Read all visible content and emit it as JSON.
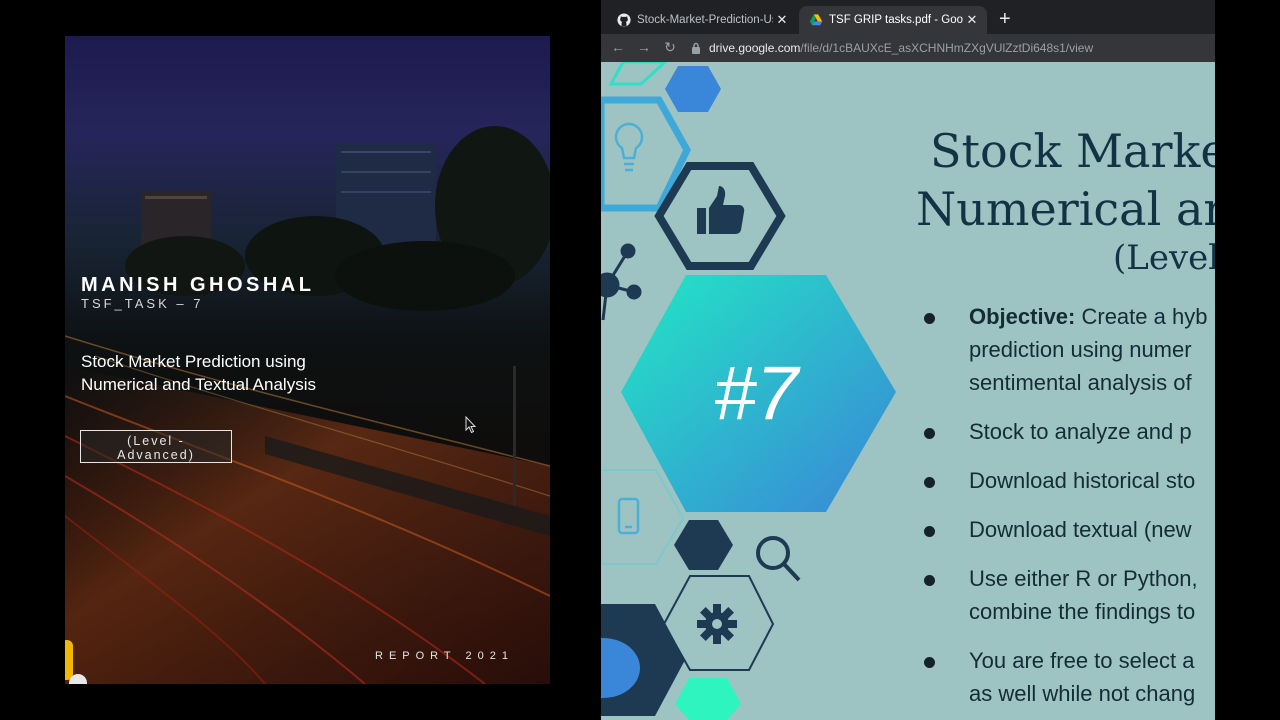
{
  "cover": {
    "name": "MANISH GHOSHAL",
    "task": "TSF_TASK – 7",
    "subtitle_line1": "Stock Market Prediction using",
    "subtitle_line2": "Numerical and Textual Analysis",
    "level_line1": "(Level -",
    "level_line2": "Advanced)",
    "report": "REPORT 2021"
  },
  "browser": {
    "tabs": [
      {
        "title": "Stock-Market-Prediction-Using",
        "icon": "github-icon"
      },
      {
        "title": "TSF GRIP tasks.pdf - Google D",
        "icon": "google-drive-icon"
      }
    ],
    "new_tab": "+",
    "url_host": "drive.google.com",
    "url_path": "/file/d/1cBAUXcE_asXCHNHmZXgVUlZztDi648s1/view"
  },
  "slide": {
    "number": "#7",
    "title_line1": "Stock Marke",
    "title_line2": "Numerical ar",
    "level": "(Level",
    "bullets": [
      {
        "bold": "Objective:",
        "line1": " Create a hyb",
        "line2": "prediction using numer",
        "line3": "sentimental analysis of"
      },
      {
        "line1": "Stock to analyze and p"
      },
      {
        "line1": "Download historical sto"
      },
      {
        "line1": "Download textual (new"
      },
      {
        "line1": "Use either R or Python,",
        "line2": "combine the findings to"
      },
      {
        "line1": "You are free to select a",
        "line2": "as well while not chang"
      }
    ]
  },
  "colors": {
    "slide_bg": "#9ec3c3",
    "navy": "#1e3a52",
    "teal": "#2ee0c8",
    "blue": "#3a86d8"
  }
}
